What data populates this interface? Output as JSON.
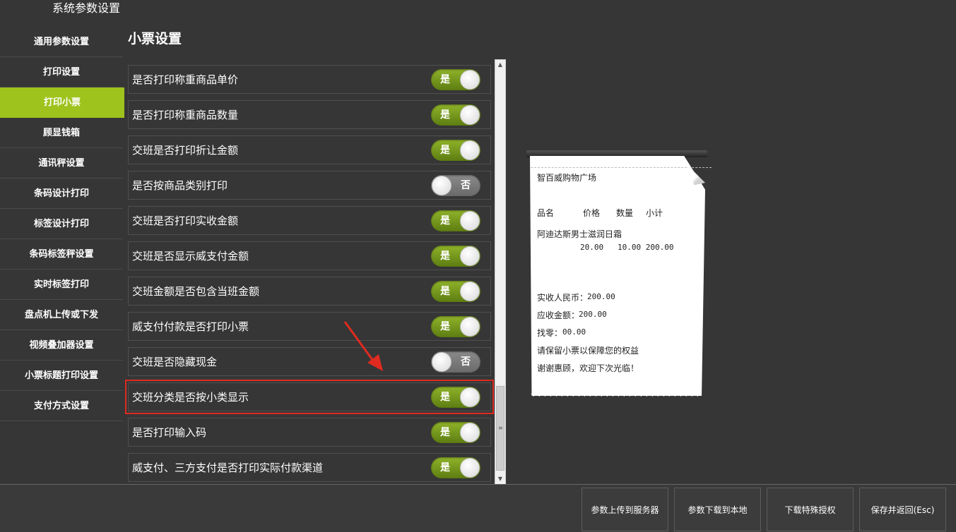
{
  "window": {
    "title": "系统参数设置"
  },
  "sidebar": {
    "items": [
      {
        "label": "通用参数设置",
        "active": false
      },
      {
        "label": "打印设置",
        "active": false
      },
      {
        "label": "打印小票",
        "active": true
      },
      {
        "label": "顾显钱箱",
        "active": false
      },
      {
        "label": "通讯秤设置",
        "active": false
      },
      {
        "label": "条码设计打印",
        "active": false
      },
      {
        "label": "标签设计打印",
        "active": false
      },
      {
        "label": "条码标签秤设置",
        "active": false
      },
      {
        "label": "实时标签打印",
        "active": false
      },
      {
        "label": "盘点机上传或下发",
        "active": false
      },
      {
        "label": "视频叠加器设置",
        "active": false
      },
      {
        "label": "小票标题打印设置",
        "active": false
      },
      {
        "label": "支付方式设置",
        "active": false
      }
    ]
  },
  "section": {
    "title": "小票设置"
  },
  "settings": [
    {
      "label": "是否打印称重商品单价",
      "value": "是",
      "on": true
    },
    {
      "label": "是否打印称重商品数量",
      "value": "是",
      "on": true
    },
    {
      "label": "交班是否打印折让金额",
      "value": "是",
      "on": true
    },
    {
      "label": "是否按商品类别打印",
      "value": "否",
      "on": false
    },
    {
      "label": "交班是否打印实收金额",
      "value": "是",
      "on": true
    },
    {
      "label": "交班是否显示威支付金额",
      "value": "是",
      "on": true
    },
    {
      "label": "交班金额是否包含当班金额",
      "value": "是",
      "on": true
    },
    {
      "label": "威支付付款是否打印小票",
      "value": "是",
      "on": true
    },
    {
      "label": "交班是否隐藏现金",
      "value": "否",
      "on": false
    },
    {
      "label": "交班分类是否按小类显示",
      "value": "是",
      "on": true,
      "highlighted": true
    },
    {
      "label": "是否打印输入码",
      "value": "是",
      "on": true
    },
    {
      "label": "威支付、三方支付是否打印实际付款渠道",
      "value": "是",
      "on": true
    }
  ],
  "receipt": {
    "store": "智百威购物广场",
    "header_name": "品名",
    "header_price": "价格",
    "header_qty": "数量",
    "header_subtotal": "小计",
    "item_name": "阿迪达斯男士滋润日霜",
    "item_values": "20.00   10.00 200.00",
    "paid_label": "实收人民币：",
    "paid_value": "200.00",
    "due_label": "应收金额：",
    "due_value": "200.00",
    "change_label": "找零：",
    "change_value": "00.00",
    "note1": "请保留小票以保障您的权益",
    "note2": "谢谢惠顾，欢迎下次光临！"
  },
  "footer": {
    "upload_label": "参数上传到服务器",
    "download_label": "参数下载到本地",
    "license_label": "下载特殊授权",
    "save_label": "保存并返回(Esc)"
  },
  "colors": {
    "accent": "#9ec31c",
    "toggle_on": "#6f9a1a",
    "highlight": "#e02b20",
    "background": "#363636"
  }
}
